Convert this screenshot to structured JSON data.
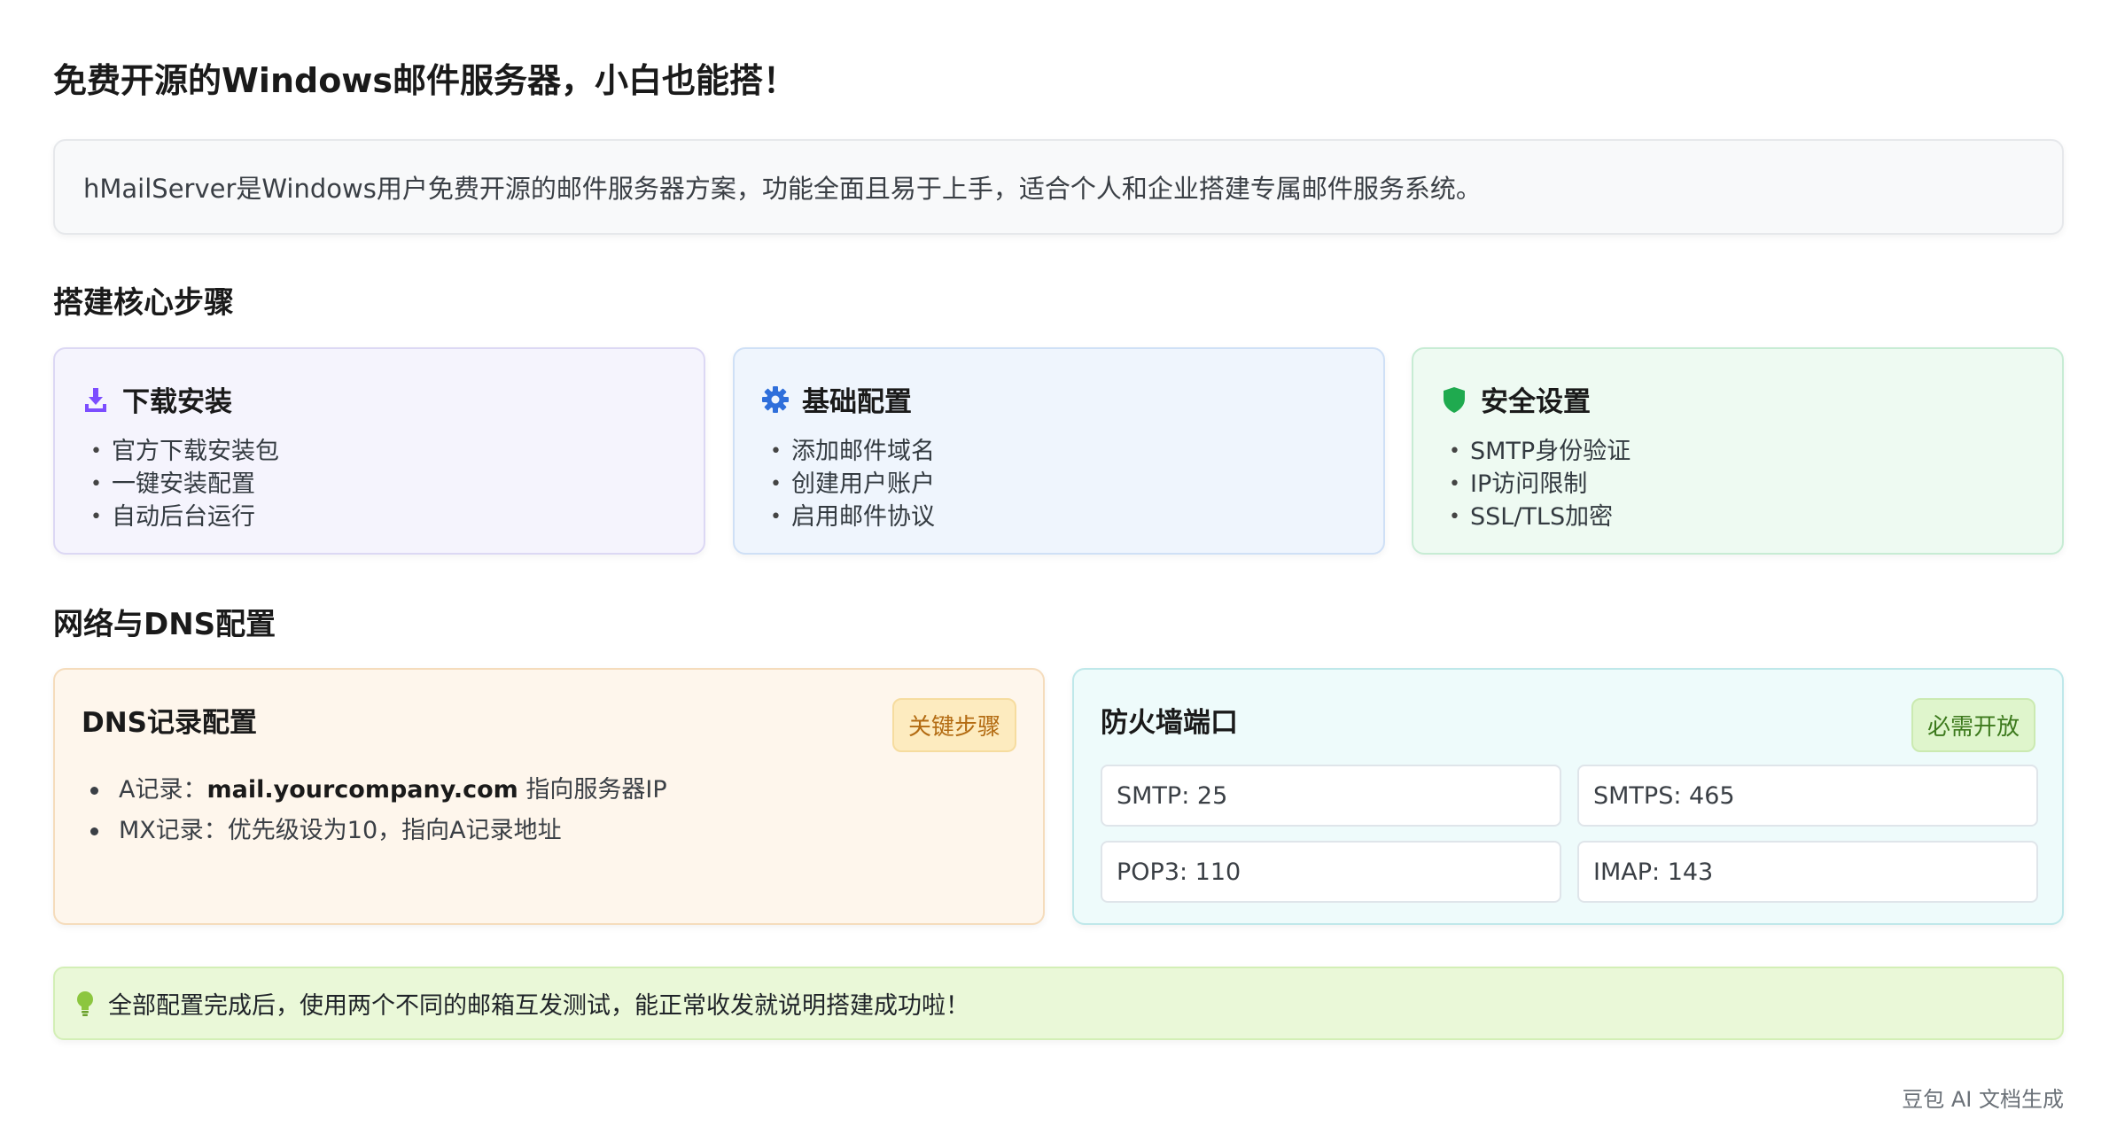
{
  "main_title": "免费开源的Windows邮件服务器，小白也能搭！",
  "intro": "hMailServer是Windows用户免费开源的邮件服务器方案，功能全面且易于上手，适合个人和企业搭建专属邮件服务系统。",
  "steps_section_title": "搭建核心步骤",
  "steps": [
    {
      "icon": "download-icon",
      "title": "下载安装",
      "items": [
        "官方下载安装包",
        "一键安装配置",
        "自动后台运行"
      ]
    },
    {
      "icon": "gear-icon",
      "title": "基础配置",
      "items": [
        "添加邮件域名",
        "创建用户账户",
        "启用邮件协议"
      ]
    },
    {
      "icon": "shield-icon",
      "title": "安全设置",
      "items": [
        "SMTP身份验证",
        "IP访问限制",
        "SSL/TLS加密"
      ]
    }
  ],
  "network_section_title": "网络与DNS配置",
  "dns": {
    "title": "DNS记录配置",
    "badge": "关键步骤",
    "a_prefix": "A记录：",
    "a_domain": "mail.yourcompany.com",
    "a_suffix": " 指向服务器IP",
    "mx": "MX记录：优先级设为10，指向A记录地址"
  },
  "firewall": {
    "title": "防火墙端口",
    "badge": "必需开放",
    "ports": [
      "SMTP: 25",
      "SMTPS: 465",
      "POP3: 110",
      "IMAP: 143"
    ]
  },
  "tip": {
    "icon": "lightbulb-icon",
    "text": "全部配置完成后，使用两个不同的邮箱互发测试，能正常收发就说明搭建成功啦！"
  },
  "footer": "豆包 AI 文档生成",
  "colors": {
    "purple": "#7c4dff",
    "blue": "#2f6fdb",
    "green": "#1faa4f",
    "bulb": "#8cc63f"
  }
}
